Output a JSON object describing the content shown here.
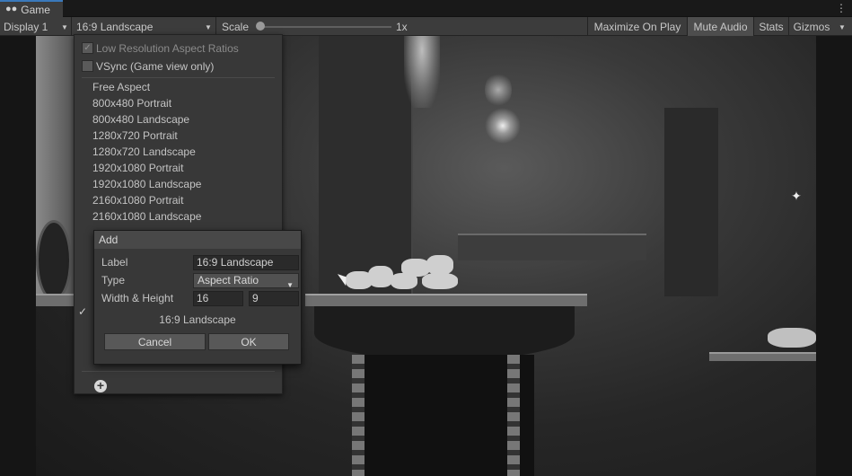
{
  "tab": {
    "label": "Game",
    "icon": "gamepad-icon",
    "menu_icon": "kebab-icon"
  },
  "toolbar": {
    "display_label": "Display 1",
    "aspect_label": "16:9 Landscape",
    "scale_label": "Scale",
    "scale_value": "1x",
    "maximize_label": "Maximize On Play",
    "mute_label": "Mute Audio",
    "stats_label": "Stats",
    "gizmos_label": "Gizmos"
  },
  "aspect_menu": {
    "low_res_label": "Low Resolution Aspect Ratios",
    "low_res_checked": true,
    "vsync_label": "VSync (Game view only)",
    "vsync_checked": false,
    "options": [
      "Free Aspect",
      "800x480 Portrait",
      "800x480 Landscape",
      "1280x720 Portrait",
      "1280x720 Landscape",
      "1920x1080 Portrait",
      "1920x1080 Landscape",
      "2160x1080 Portrait",
      "2160x1080 Landscape"
    ],
    "add_icon": "plus-circle-icon",
    "selected_icon": "checkmark-icon"
  },
  "add_dialog": {
    "title": "Add",
    "label_caption": "Label",
    "label_value": "16:9 Landscape",
    "type_caption": "Type",
    "type_value": "Aspect Ratio",
    "size_caption": "Width & Height",
    "width_value": "16",
    "height_value": "9",
    "preview": "16:9 Landscape",
    "cancel_label": "Cancel",
    "ok_label": "OK"
  }
}
